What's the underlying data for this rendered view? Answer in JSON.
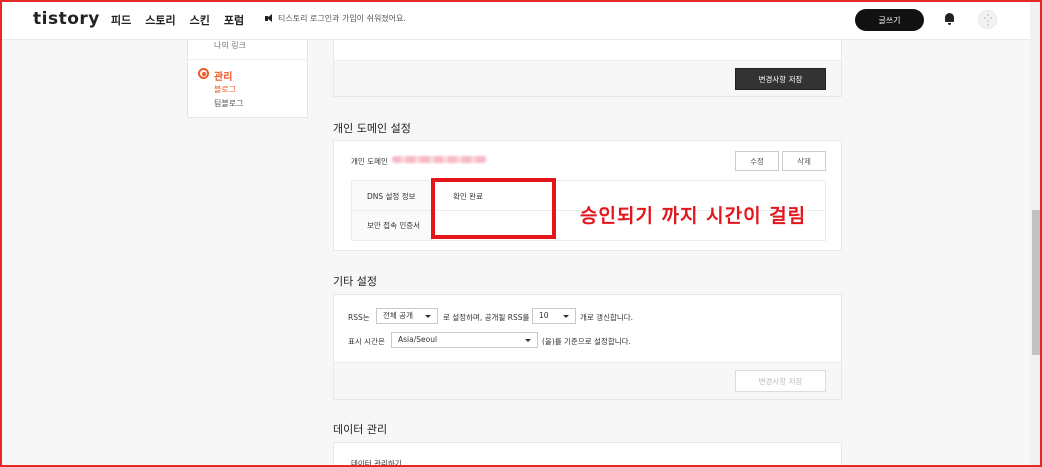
{
  "header": {
    "logo": "tistory",
    "nav": [
      "피드",
      "스토리",
      "스킨",
      "포럼"
    ],
    "notice": "티스토리 로그인과 가입이 쉬워졌어요.",
    "write_button": "글쓰기"
  },
  "sidebar": {
    "prev_item": "나의 링크",
    "section_title": "관리",
    "items": [
      "블로그",
      "팀블로그"
    ]
  },
  "top_card": {
    "save_button": "변경사항 저장"
  },
  "domain_section": {
    "title": "개인 도메인 설정",
    "label": "개인 도메인",
    "edit_button": "수정",
    "delete_button": "삭제",
    "rows": [
      {
        "label": "DNS 설정 정보",
        "value": "확인 완료"
      },
      {
        "label": "보안 접속 인증서",
        "value": ""
      }
    ]
  },
  "annotation": {
    "text": "승인되기 까지 시간이 걸림",
    "color": "#e3161c"
  },
  "other_section": {
    "title": "기타 설정",
    "rss_prefix": "RSS는",
    "rss_scope": "전체 공개",
    "rss_middle": "로 설정하며, 공개될 RSS를",
    "rss_count": "10",
    "rss_suffix": "개로 갱신합니다.",
    "time_prefix": "표시 시간은",
    "timezone": "Asia/Seoul",
    "time_suffix": "(을)를 기준으로 설정합니다.",
    "save_button": "변경사항 저장"
  },
  "data_section": {
    "title": "데이터 관리",
    "first_item": "데이터 관리하기"
  },
  "colors": {
    "accent": "#f05a28",
    "annotation": "#e3161c",
    "dark_button": "#333333"
  }
}
